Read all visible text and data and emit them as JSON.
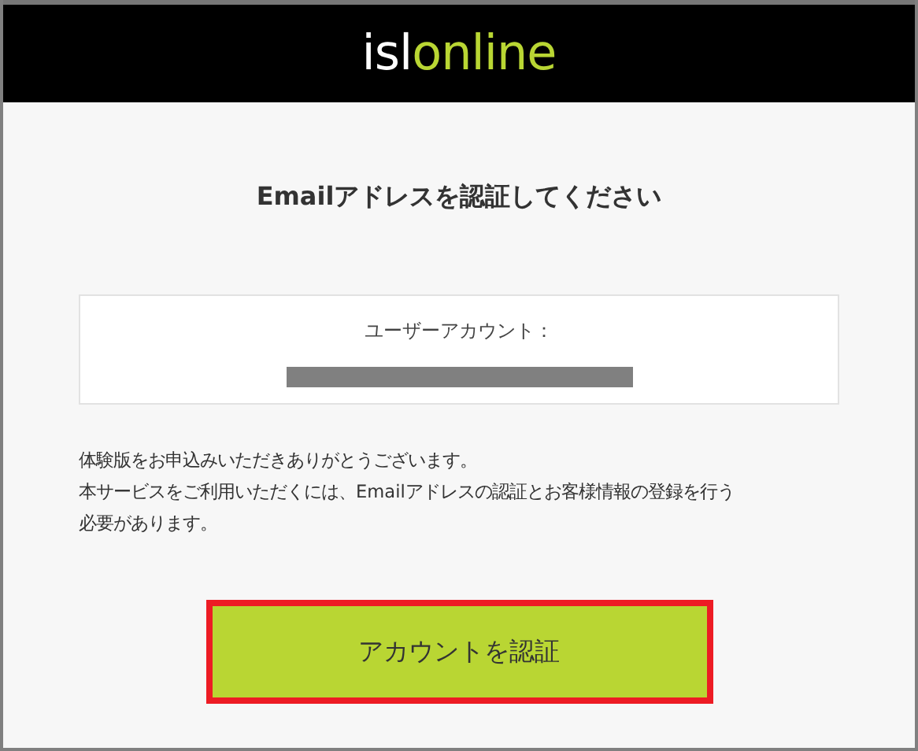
{
  "logo": {
    "parts": [
      {
        "text": "isl",
        "color": "#ffffff"
      },
      {
        "text": "online",
        "color": "#b9d633"
      }
    ]
  },
  "title": "Emailアドレスを認証してください",
  "account_card": {
    "label": "ユーザーアカウント：",
    "value_redacted": true
  },
  "message_lines": [
    "体験版をお申込みいただきありがとうございます。",
    "本サービスをご利用いただくには、Emailアドレスの認証とお客様情報の登録を行う",
    "必要があります。"
  ],
  "verify_button": {
    "label": "アカウントを認証",
    "highlighted": true
  }
}
